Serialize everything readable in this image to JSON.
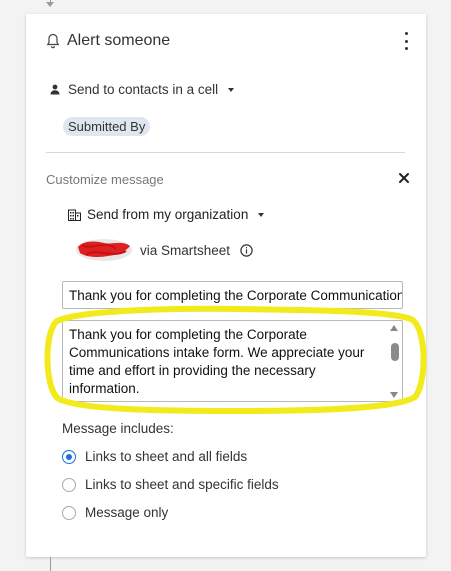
{
  "panel": {
    "title": "Alert someone",
    "recipients_label": "Send to contacts in a cell",
    "recipient_chip": "Submitted By"
  },
  "customize": {
    "section_label": "Customize message",
    "sender_label": "Send from my organization",
    "via_label": "via Smartsheet",
    "subject_value": "Thank you for completing the Corporate Communications intake form",
    "message_value": "Thank you for completing the Corporate Communications intake form. We appreciate your time and effort in providing the necessary information."
  },
  "includes": {
    "label": "Message includes:",
    "options": [
      {
        "label": "Links to sheet and all fields",
        "selected": true
      },
      {
        "label": "Links to sheet and specific fields",
        "selected": false
      },
      {
        "label": "Message only",
        "selected": false
      }
    ]
  },
  "colors": {
    "accent": "#1d6fe0",
    "highlight": "#f2ea1a",
    "redaction": "#e02020",
    "chip_bg": "#dfe6ef"
  },
  "icons": {
    "header": "bell-icon",
    "recipients": "person-icon",
    "sender": "building-icon",
    "info": "info-icon",
    "menu": "kebab-icon",
    "close": "close-icon"
  }
}
